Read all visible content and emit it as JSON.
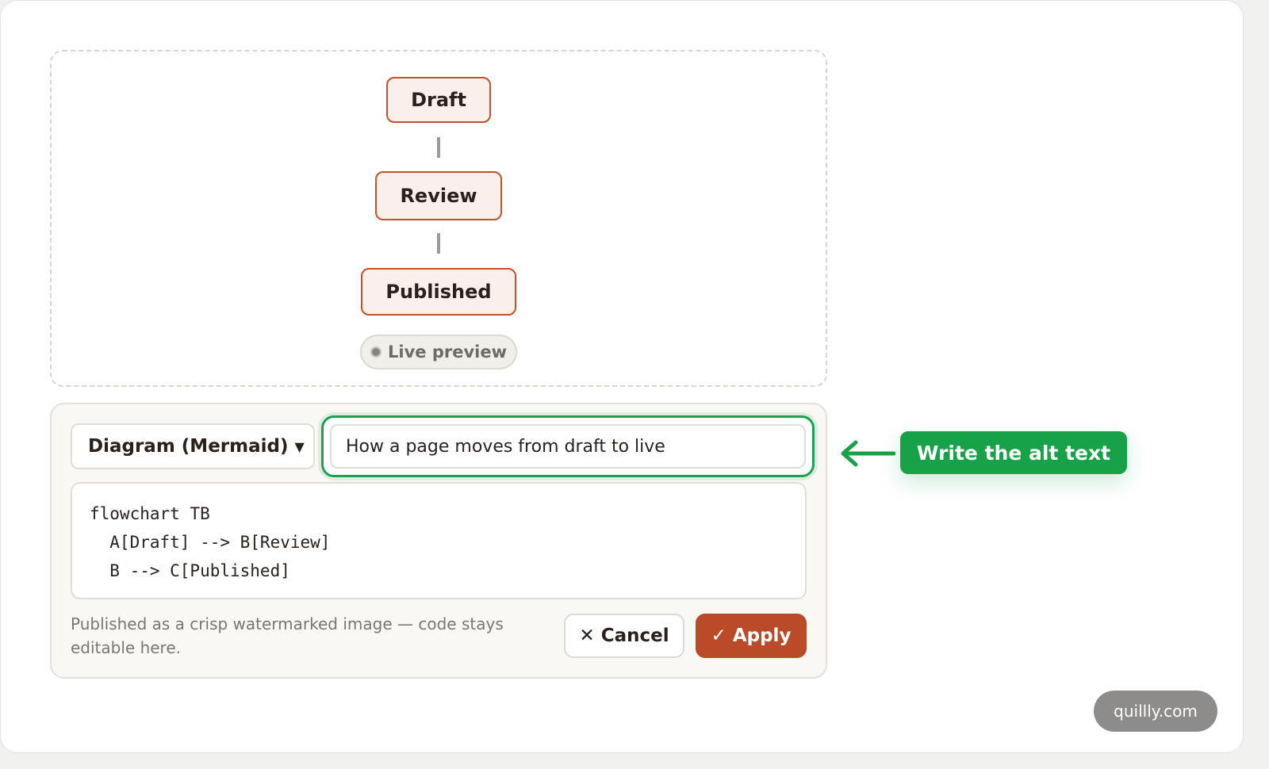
{
  "preview": {
    "nodes": [
      {
        "label": "Draft"
      },
      {
        "label": "Review"
      },
      {
        "label": "Published"
      }
    ],
    "badge": "Live preview"
  },
  "editor": {
    "type_select": "Diagram (Mermaid)",
    "alt_text_value": "How a page moves from draft to live",
    "code_lines": [
      "flowchart TB",
      "  A[Draft] --> B[Review]",
      "  B --> C[Published]"
    ],
    "hint": "Published as a crisp watermarked image — code stays editable here.",
    "cancel_label": "Cancel",
    "apply_label": "Apply",
    "cancel_icon": "✕",
    "apply_icon": "✓"
  },
  "callout": {
    "text": "Write the alt text"
  },
  "watermark": "quillly.com",
  "colors": {
    "accent": "#b94b29",
    "node_fill": "#fbefe9",
    "highlight": "#17a24a"
  }
}
